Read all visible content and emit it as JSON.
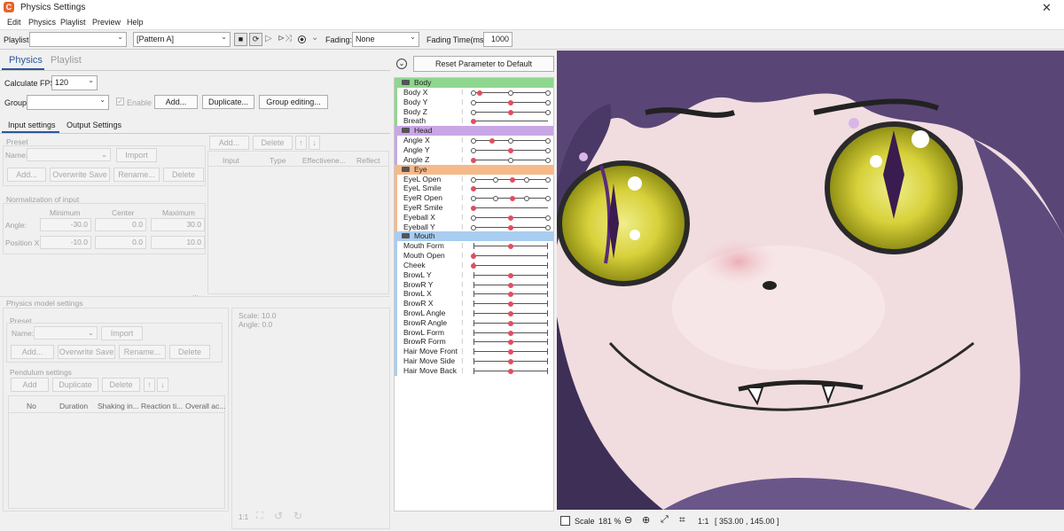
{
  "window": {
    "title": "Physics Settings",
    "close_glyph": "✕",
    "logo_glyph": "C"
  },
  "menu": [
    "Edit",
    "Physics",
    "Playlist",
    "Preview",
    "Help"
  ],
  "toolbar": {
    "playlist_label": "Playlist:",
    "playlist_value": "",
    "pattern_value": "[Pattern A]",
    "fading_label": "Fading:",
    "fading_value": "None",
    "fading_time_label": "Fading Time(ms):",
    "fading_time_value": "1000"
  },
  "tabs": {
    "physics": "Physics",
    "playlist": "Playlist"
  },
  "fps": {
    "label": "Calculate FPS:",
    "value": "120"
  },
  "group": {
    "label": "Group:",
    "value": "",
    "enable_label": "Enable",
    "add": "Add...",
    "duplicate": "Duplicate...",
    "group_editing": "Group editing..."
  },
  "subtabs": {
    "input": "Input settings",
    "output": "Output Settings"
  },
  "preset": {
    "title": "Preset",
    "name_label": "Name:",
    "import": "Import",
    "add": "Add...",
    "overwrite": "Overwrite Save",
    "rename": "Rename...",
    "delete": "Delete"
  },
  "input_table": {
    "add": "Add...",
    "delete": "Delete",
    "up": "↑",
    "down": "↓",
    "columns": [
      "Input",
      "Type",
      "Effectivene...",
      "Reflect"
    ]
  },
  "normalization": {
    "title": "Normalization of input",
    "columns": [
      "Minimum",
      "Center",
      "Maximum"
    ],
    "rows": [
      {
        "label": "Angle:",
        "min": "-30.0",
        "center": "0.0",
        "max": "30.0"
      },
      {
        "label": "Position X:",
        "min": "-10.0",
        "center": "0.0",
        "max": "10.0"
      }
    ]
  },
  "splitter": "...",
  "physics_model": {
    "title": "Physics model settings",
    "preset_title": "Preset",
    "name_label": "Name:",
    "import": "Import",
    "add": "Add...",
    "overwrite": "Overwrite Save",
    "rename": "Rename...",
    "delete": "Delete"
  },
  "pendulum": {
    "title": "Pendulum settings",
    "add": "Add",
    "duplicate": "Duplicate",
    "delete": "Delete",
    "up": "↑",
    "down": "↓",
    "columns": [
      "No",
      "Duration",
      "Shaking in...",
      "Reaction ti...",
      "Overall ac..."
    ]
  },
  "preview": {
    "scale": "Scale: 10.0",
    "angle": "Angle: 0.0",
    "one_to_one": "1:1"
  },
  "reset_button": "Reset Parameter to Default",
  "param_groups": [
    {
      "name": "Body",
      "color": "#8fd68f",
      "params": [
        {
          "name": "Body X",
          "knots": [
            0,
            0.08,
            0.5,
            1
          ],
          "key": 0.08
        },
        {
          "name": "Body Y",
          "knots": [
            0,
            0.5,
            1
          ],
          "key": 0.5
        },
        {
          "name": "Body Z",
          "knots": [
            0,
            0.5,
            1
          ],
          "key": 0.5
        },
        {
          "name": "Breath",
          "knots": [
            0
          ],
          "key": 0
        }
      ]
    },
    {
      "name": "Head",
      "color": "#c9a6e6",
      "params": [
        {
          "name": "Angle X",
          "knots": [
            0,
            0.25,
            0.5,
            1
          ],
          "key": 0.25
        },
        {
          "name": "Angle Y",
          "knots": [
            0,
            0.5,
            1
          ],
          "key": 0.5
        },
        {
          "name": "Angle Z",
          "knots": [
            0,
            0.5,
            1
          ],
          "key": 0
        }
      ]
    },
    {
      "name": "Eye",
      "color": "#f6b98a",
      "params": [
        {
          "name": "EyeL Open",
          "knots": [
            0,
            0.3,
            0.52,
            0.72,
            1
          ],
          "key": 0.52
        },
        {
          "name": "EyeL Smile",
          "knots": [
            0
          ],
          "key": 0
        },
        {
          "name": "EyeR Open",
          "knots": [
            0,
            0.3,
            0.52,
            0.72,
            1
          ],
          "key": 0.52
        },
        {
          "name": "EyeR Smile",
          "knots": [
            0
          ],
          "key": 0
        },
        {
          "name": "Eyeball X",
          "knots": [
            0,
            0.5,
            1
          ],
          "key": 0.5
        },
        {
          "name": "Eyeball Y",
          "knots": [
            0,
            0.5,
            1
          ],
          "key": 0.5
        }
      ]
    },
    {
      "name": "Mouth",
      "color": "#a9cdf0",
      "params": [
        {
          "name": "Mouth Form",
          "knots": [],
          "key": 0.5
        },
        {
          "name": "Mouth Open",
          "knots": [],
          "key": 0
        },
        {
          "name": "Cheek",
          "knots": [],
          "key": 0
        },
        {
          "name": "BrowL Y",
          "knots": [],
          "key": 0.5
        },
        {
          "name": "BrowR Y",
          "knots": [],
          "key": 0.5
        },
        {
          "name": "BrowL X",
          "knots": [],
          "key": 0.5
        },
        {
          "name": "BrowR X",
          "knots": [],
          "key": 0.5
        },
        {
          "name": "BrowL Angle",
          "knots": [],
          "key": 0.5
        },
        {
          "name": "BrowR Angle",
          "knots": [],
          "key": 0.5
        },
        {
          "name": "BrowL Form",
          "knots": [],
          "key": 0.5
        },
        {
          "name": "BrowR Form",
          "knots": [],
          "key": 0.5
        },
        {
          "name": "Hair Move Front",
          "knots": [],
          "key": 0.5
        },
        {
          "name": "Hair Move Side",
          "knots": [],
          "key": 0.5
        },
        {
          "name": "Hair Move Back",
          "knots": [],
          "key": 0.5
        }
      ]
    }
  ],
  "status": {
    "scale_label": "Scale",
    "zoom": "181 %",
    "one_to_one": "1:1",
    "coords": "[ 353.00 , 145.00 ]"
  }
}
